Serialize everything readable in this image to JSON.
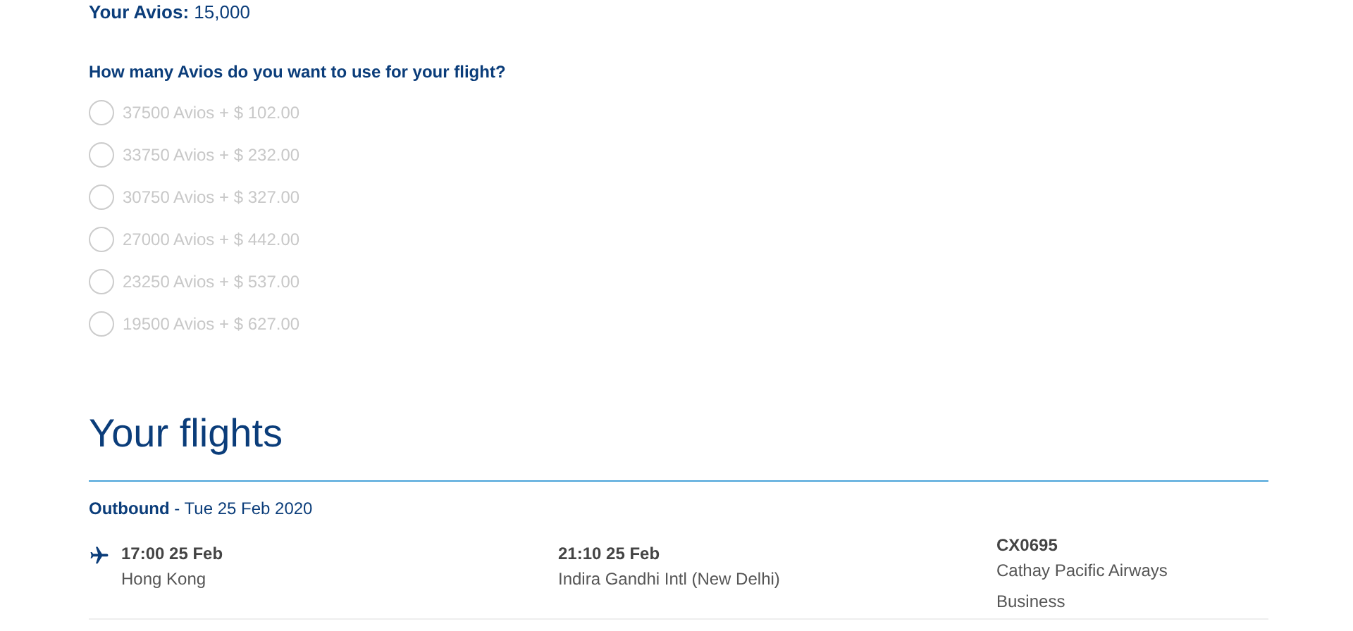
{
  "avios": {
    "label": "Your Avios:",
    "value": "15,000"
  },
  "question": "How many Avios do you want to use for your flight?",
  "options": [
    {
      "label": "37500 Avios + $ 102.00",
      "selected": false,
      "disabled": true
    },
    {
      "label": "33750 Avios + $ 232.00",
      "selected": false,
      "disabled": true
    },
    {
      "label": "30750 Avios + $ 327.00",
      "selected": false,
      "disabled": true
    },
    {
      "label": "27000 Avios + $ 442.00",
      "selected": false,
      "disabled": true
    },
    {
      "label": "23250 Avios + $ 537.00",
      "selected": false,
      "disabled": true
    },
    {
      "label": "19500 Avios + $ 627.00",
      "selected": false,
      "disabled": true
    }
  ],
  "flights_title": "Your flights",
  "outbound": {
    "label": "Outbound",
    "date": "- Tue 25 Feb 2020",
    "departure": {
      "time": "17:00 25 Feb",
      "place": "Hong Kong"
    },
    "arrival": {
      "time": "21:10 25 Feb",
      "place": "Indira Gandhi Intl (New Delhi)"
    },
    "flight": {
      "number": "CX0695",
      "airline": "Cathay Pacific Airways",
      "cabin": "Business"
    }
  }
}
